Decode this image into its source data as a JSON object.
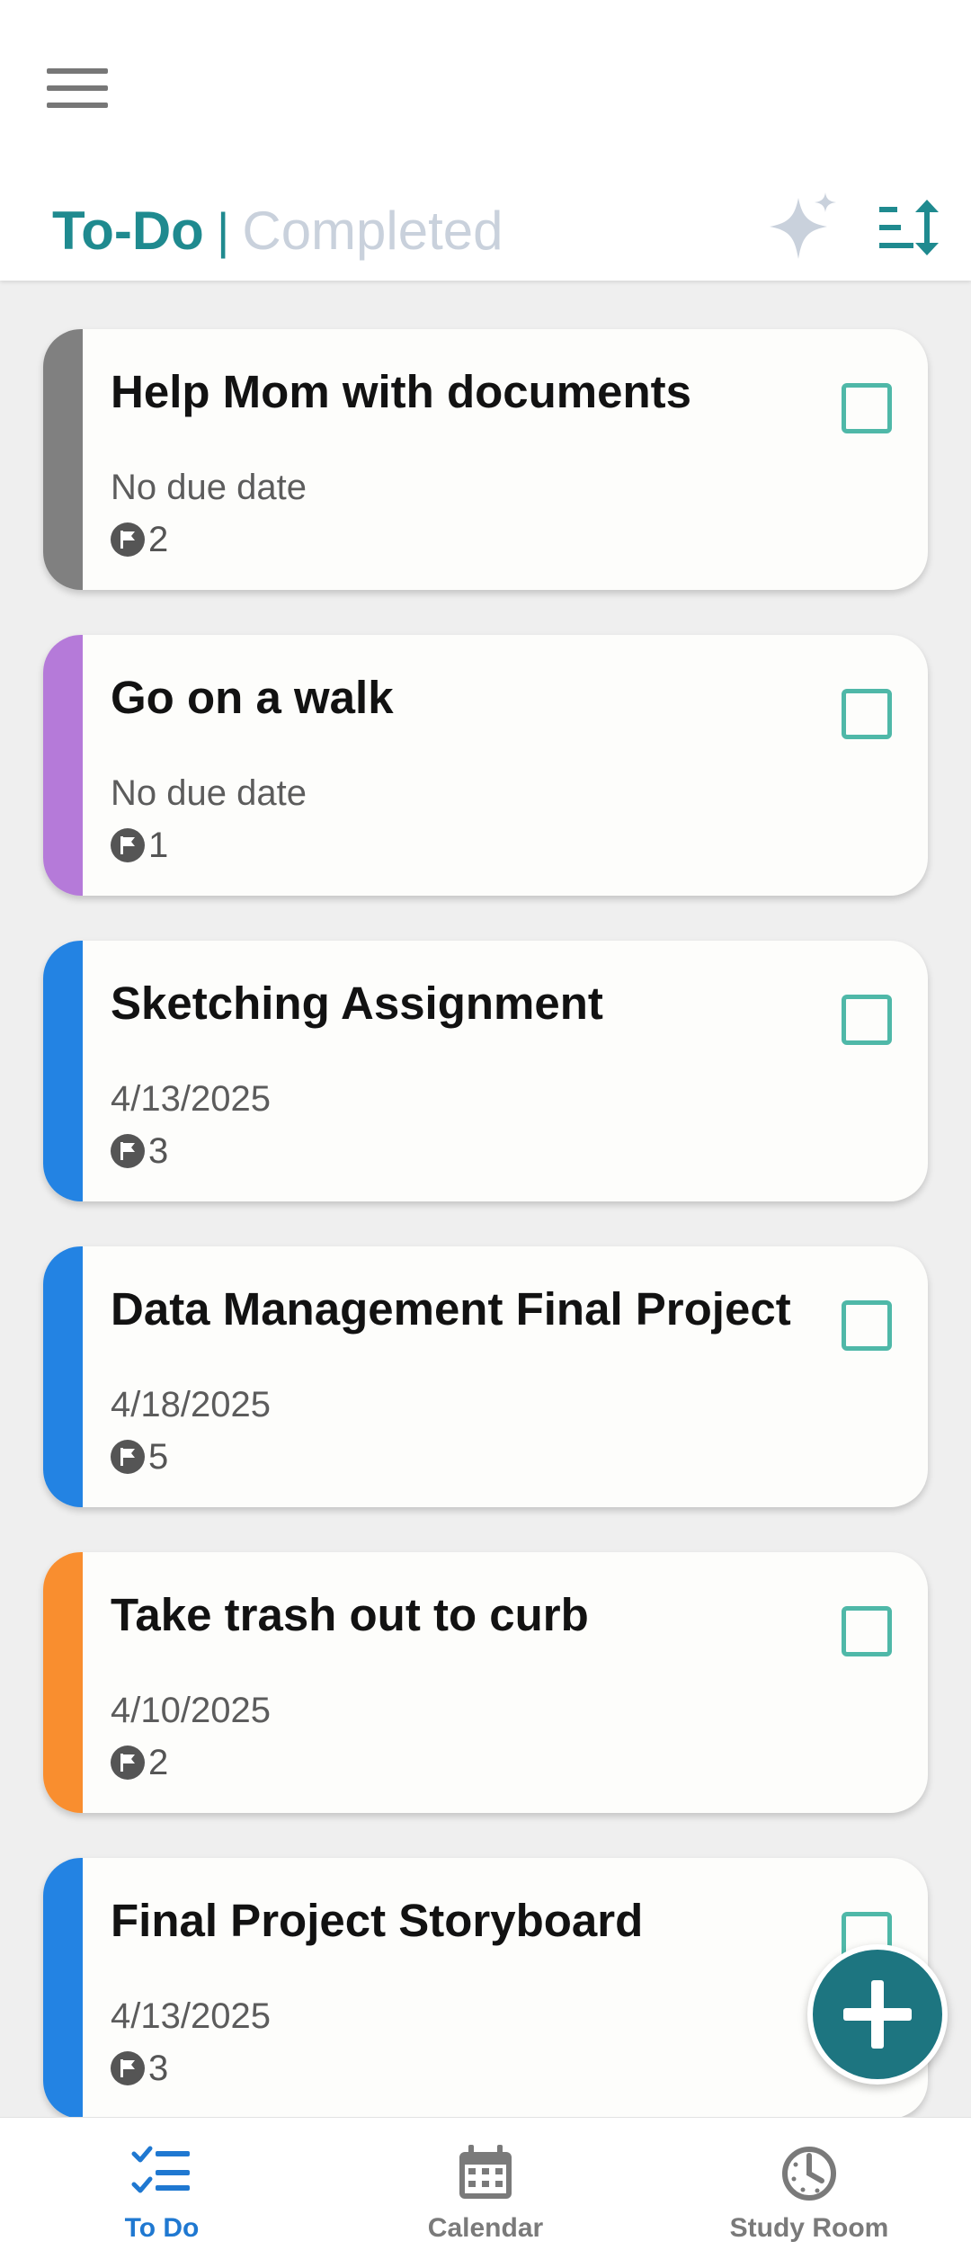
{
  "header": {
    "tab_todo": "To-Do",
    "separator": "|",
    "tab_completed": "Completed"
  },
  "colors": {
    "accent_teal": "#1f8a8f",
    "checkbox_teal": "#4fb8a8",
    "nav_active_blue": "#1f78d1",
    "fab": "#1d7580"
  },
  "tasks": [
    {
      "title": "Help Mom with documents",
      "date": "No due date",
      "priority": "2",
      "color": "#808080"
    },
    {
      "title": "Go on a walk",
      "date": "No due date",
      "priority": "1",
      "color": "#b57ad9"
    },
    {
      "title": "Sketching Assignment",
      "date": "4/13/2025",
      "priority": "3",
      "color": "#2383e3"
    },
    {
      "title": "Data Management Final Project",
      "date": "4/18/2025",
      "priority": "5",
      "color": "#2383e3"
    },
    {
      "title": "Take trash out to curb",
      "date": "4/10/2025",
      "priority": "2",
      "color": "#f98e2f"
    },
    {
      "title": "Final Project Storyboard",
      "date": "4/13/2025",
      "priority": "3",
      "color": "#2383e3"
    }
  ],
  "nav": {
    "todo": "To Do",
    "calendar": "Calendar",
    "study_room": "Study Room"
  },
  "icons": {
    "menu": "hamburger-menu-icon",
    "sparkle": "sparkle-icon",
    "sort": "sort-icon",
    "flag": "flag-icon",
    "add": "plus-icon",
    "todo": "checklist-icon",
    "calendar": "calendar-icon",
    "study": "timer-icon"
  }
}
